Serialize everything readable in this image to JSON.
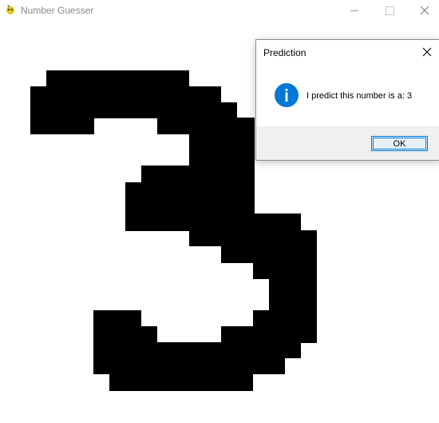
{
  "window": {
    "title": "Number Guesser",
    "icons": {
      "app": "pygame-snake-icon",
      "minimize": "minimize-icon",
      "maximize": "maximize-icon",
      "close": "close-icon"
    }
  },
  "canvas": {
    "drawn_digit": "3"
  },
  "dialog": {
    "title": "Prediction",
    "message": "I predict this number is a: 3",
    "ok_label": "OK",
    "icon": "info-icon",
    "accent": "#0078d7"
  }
}
